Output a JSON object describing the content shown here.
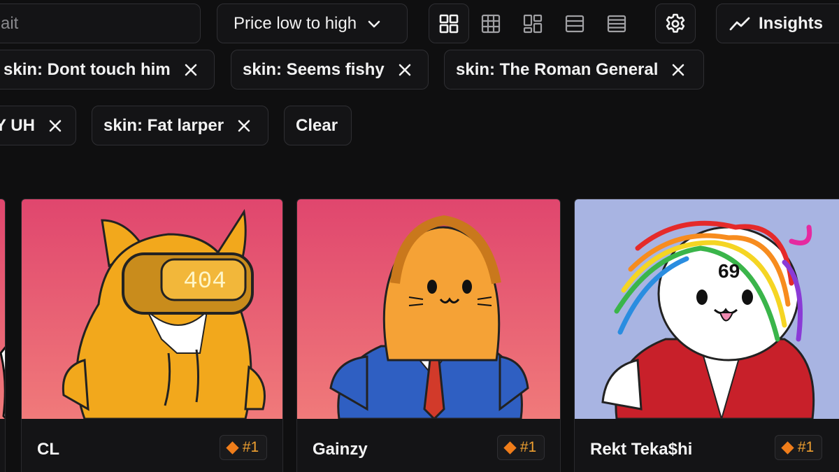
{
  "toolbar": {
    "search_text": "ait",
    "sort_label": "Price low to high",
    "insights_label": "Insights"
  },
  "filters": [
    {
      "label": "skin: Dont touch him"
    },
    {
      "label": "skin: Seems fishy"
    },
    {
      "label": "skin: The Roman General"
    },
    {
      "label": "Y UH"
    },
    {
      "label": "skin: Fat larper"
    }
  ],
  "clear_label": "Clear",
  "cards": [
    {
      "name": "CL",
      "rank": "#1",
      "art_text": "404",
      "bg_top": "#e0466e",
      "bg_bottom": "#f07a7a"
    },
    {
      "name": "Gainzy",
      "rank": "#1",
      "bg_top": "#e0466e",
      "bg_bottom": "#f07a7a"
    },
    {
      "name": "Rekt Teka$hi",
      "rank": "#1",
      "art_text": "69",
      "bg_top": "#a8b4e2",
      "bg_bottom": "#a8b4e2"
    }
  ],
  "colors": {
    "accent": "#f07d1a",
    "background": "#0f0f10"
  }
}
